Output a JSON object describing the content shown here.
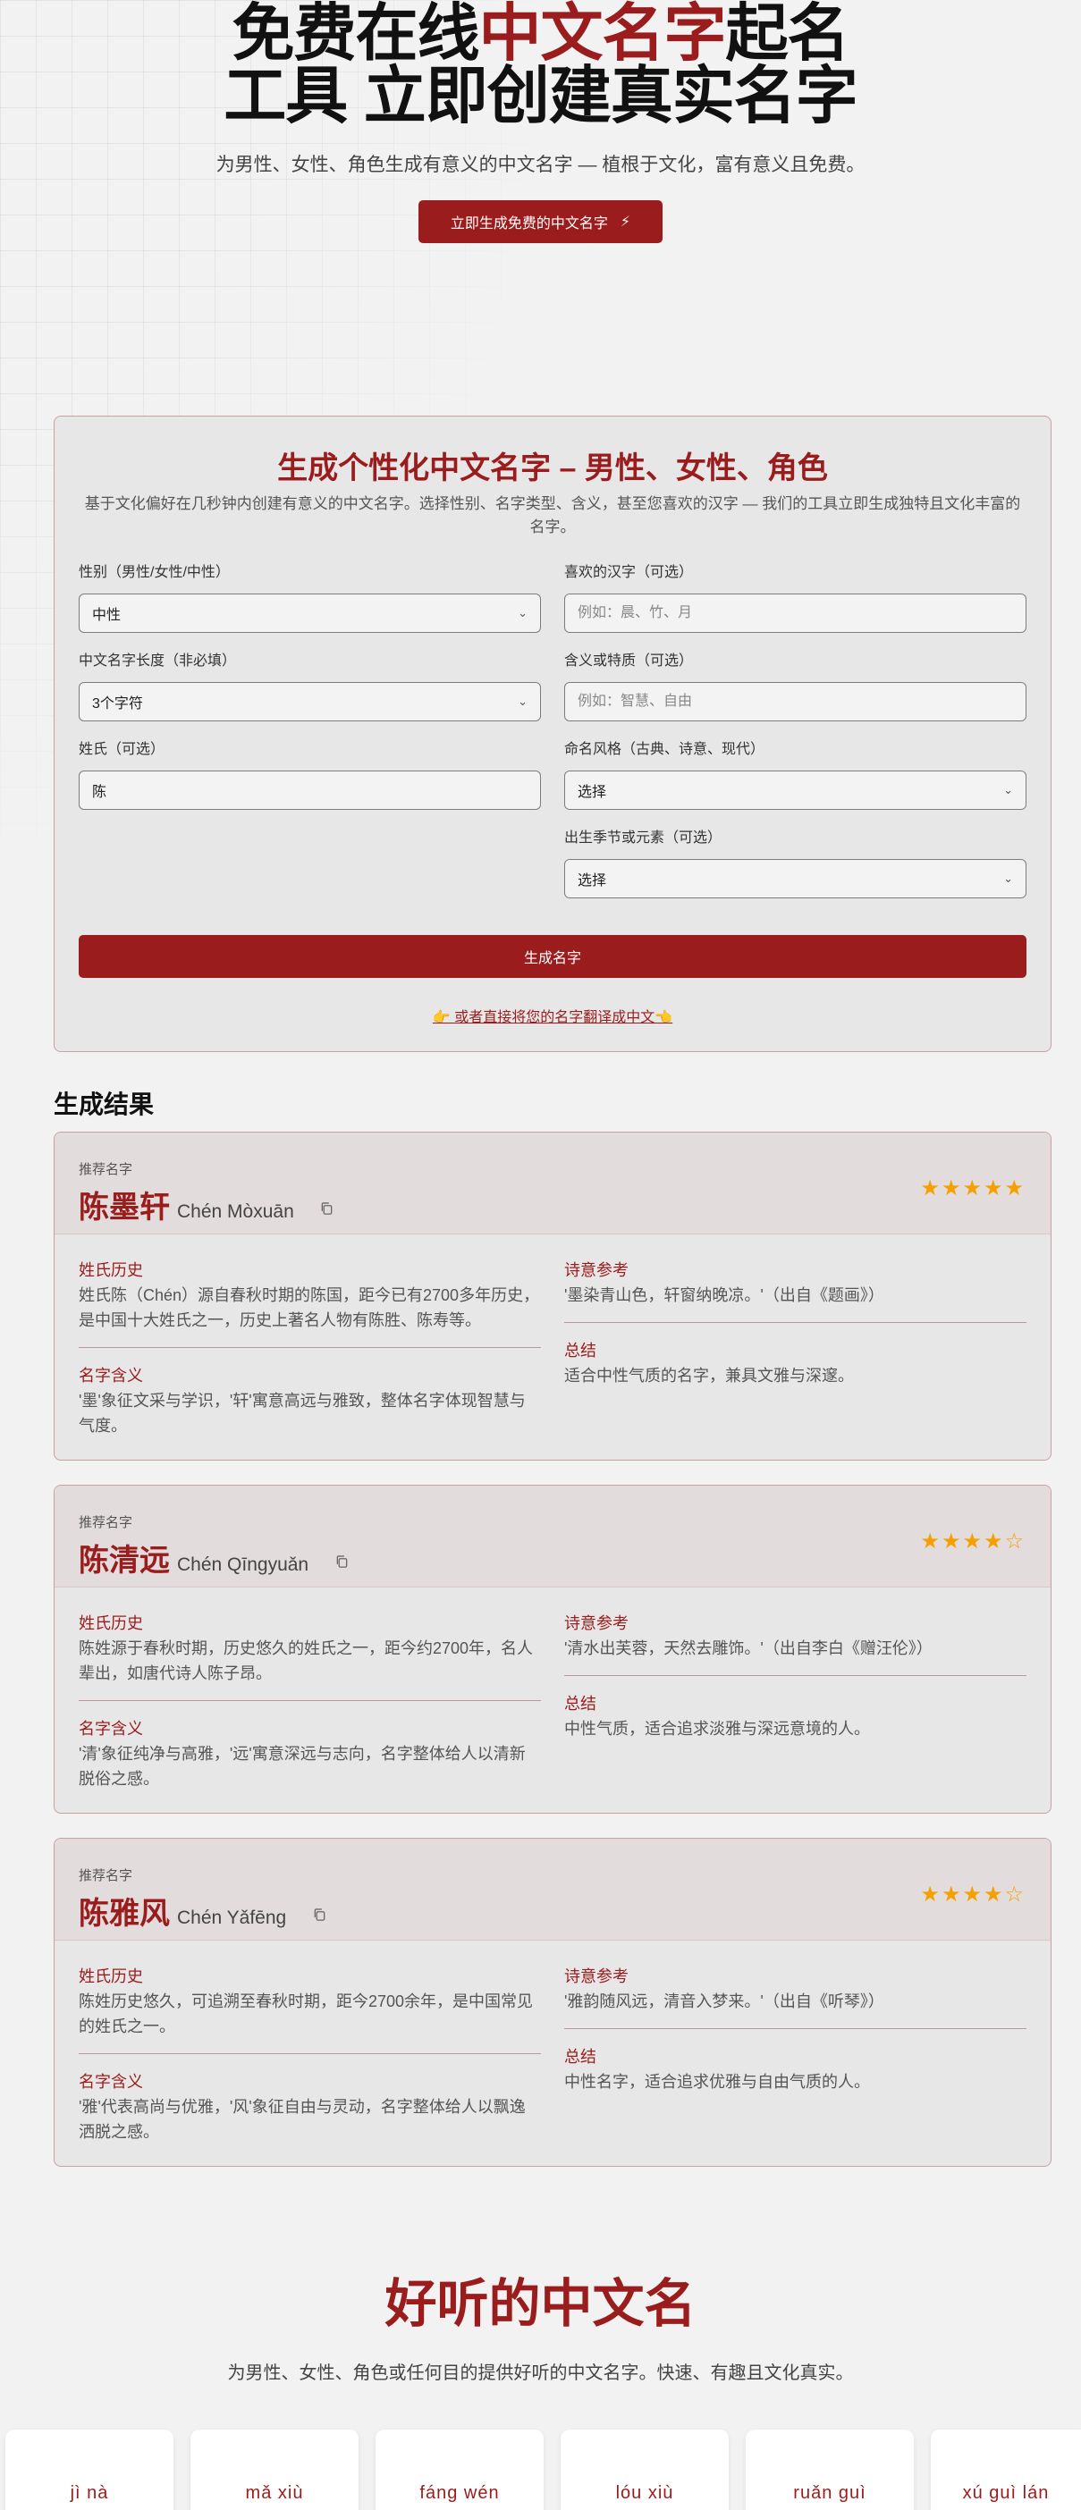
{
  "hero": {
    "title_part1": "免费在线",
    "title_accent": "中文名字",
    "title_part2": "起名",
    "title_line2": "工具 立即创建真实名字",
    "subtitle": "为男性、女性、角色生成有意义的中文名字 — 植根于文化，富有意义且免费。",
    "cta_label": "立即生成免费的中文名字",
    "cta_icon": "bolt-icon"
  },
  "form": {
    "title": "生成个性化中文名字 – 男性、女性、角色",
    "description": "基于文化偏好在几秒钟内创建有意义的中文名字。选择性别、名字类型、含义，甚至您喜欢的汉字 — 我们的工具立即生成独特且文化丰富的名字。",
    "gender_label": "性别（男性/女性/中性）",
    "gender_value": "中性",
    "favorite_label": "喜欢的汉字（可选）",
    "favorite_placeholder": "例如：晨、竹、月",
    "length_label": "中文名字长度（非必填）",
    "length_value": "3个字符",
    "meaning_label": "含义或特质（可选）",
    "meaning_placeholder": "例如：智慧、自由",
    "surname_label": "姓氏（可选）",
    "surname_value": "陈",
    "style_label": "命名风格（古典、诗意、现代）",
    "style_value": "选择",
    "season_label": "出生季节或元素（可选）",
    "season_value": "选择",
    "generate_label": "生成名字",
    "translate_link": "👉 或者直接将您的名字翻译成中文👈"
  },
  "results": {
    "title": "生成结果",
    "tag_label": "推荐名字",
    "surname_title": "姓氏历史",
    "meaning_title": "名字含义",
    "poem_title": "诗意参考",
    "summary_title": "总结",
    "items": [
      {
        "name": "陈墨轩",
        "pinyin": "Chén Mòxuān",
        "rating": 5,
        "stars": "★★★★★",
        "surname_history": "姓氏陈（Chén）源自春秋时期的陈国，距今已有2700多年历史，是中国十大姓氏之一，历史上著名人物有陈胜、陈寿等。",
        "meaning": "'墨'象征文采与学识，'轩'寓意高远与雅致，整体名字体现智慧与气度。",
        "poem": "'墨染青山色，轩窗纳晚凉。'（出自《题画》）",
        "summary": "适合中性气质的名字，兼具文雅与深邃。"
      },
      {
        "name": "陈清远",
        "pinyin": "Chén Qīngyuǎn",
        "rating": 4,
        "stars": "★★★★☆",
        "surname_history": "陈姓源于春秋时期，历史悠久的姓氏之一，距今约2700年，名人辈出，如唐代诗人陈子昂。",
        "meaning": "'清'象征纯净与高雅，'远'寓意深远与志向，名字整体给人以清新脱俗之感。",
        "poem": "'清水出芙蓉，天然去雕饰。'（出自李白《赠汪伦》）",
        "summary": "中性气质，适合追求淡雅与深远意境的人。"
      },
      {
        "name": "陈雅风",
        "pinyin": "Chén Yǎfēng",
        "rating": 4,
        "stars": "★★★★☆",
        "surname_history": "陈姓历史悠久，可追溯至春秋时期，距今2700余年，是中国常见的姓氏之一。",
        "meaning": "'雅'代表高尚与优雅，'风'象征自由与灵动，名字整体给人以飘逸洒脱之感。",
        "poem": "'雅韵随风远，清音入梦来。'（出自《听琴》）",
        "summary": "中性名字，适合追求优雅与自由气质的人。"
      }
    ]
  },
  "nice_names": {
    "title": "好听的中文名",
    "subtitle": "为男性、女性、角色或任何目的提供好听的中文名字。快速、有趣且文化真实。",
    "chips": [
      "jì  nà",
      "mǎ  xiù",
      "fáng  wén",
      "lóu  xiù",
      "ruǎn  guì",
      "xú  guì lán"
    ]
  },
  "colors": {
    "accent": "#9b1c1c",
    "star": "#f5a000",
    "page_bg": "#f2f2f3"
  }
}
